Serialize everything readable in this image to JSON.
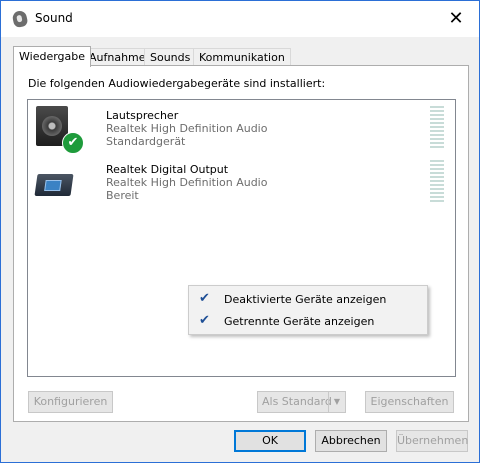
{
  "window": {
    "title": "Sound",
    "close_symbol": "✕"
  },
  "tabs": [
    {
      "label": "Wiedergabe",
      "active": true
    },
    {
      "label": "Aufnahme"
    },
    {
      "label": "Sounds"
    },
    {
      "label": "Kommunikation"
    }
  ],
  "panel": {
    "intro": "Die folgenden Audiowiedergabegeräte sind installiert:"
  },
  "devices": [
    {
      "name": "Lautsprecher",
      "driver": "Realtek High Definition Audio",
      "status": "Standardgerät",
      "icon": "speaker-icon",
      "default": true
    },
    {
      "name": "Realtek Digital Output",
      "driver": "Realtek High Definition Audio",
      "status": "Bereit",
      "icon": "digital-output-icon"
    }
  ],
  "context_menu": [
    {
      "label": "Deaktivierte Geräte anzeigen",
      "checked": true,
      "check": "✔"
    },
    {
      "label": "Getrennte Geräte anzeigen",
      "checked": true,
      "check": "✔"
    }
  ],
  "panel_buttons": {
    "configure": "Konfigurieren",
    "set_default": "Als Standard",
    "set_default_arrow": "▼",
    "properties": "Eigenschaften"
  },
  "dialog_buttons": {
    "ok": "OK",
    "cancel": "Abbrechen",
    "apply": "Übernehmen"
  },
  "badge": "✔",
  "colors": {
    "accent": "#0078d7",
    "check_green": "#1e9b3b",
    "check_blue": "#1f4f96"
  }
}
